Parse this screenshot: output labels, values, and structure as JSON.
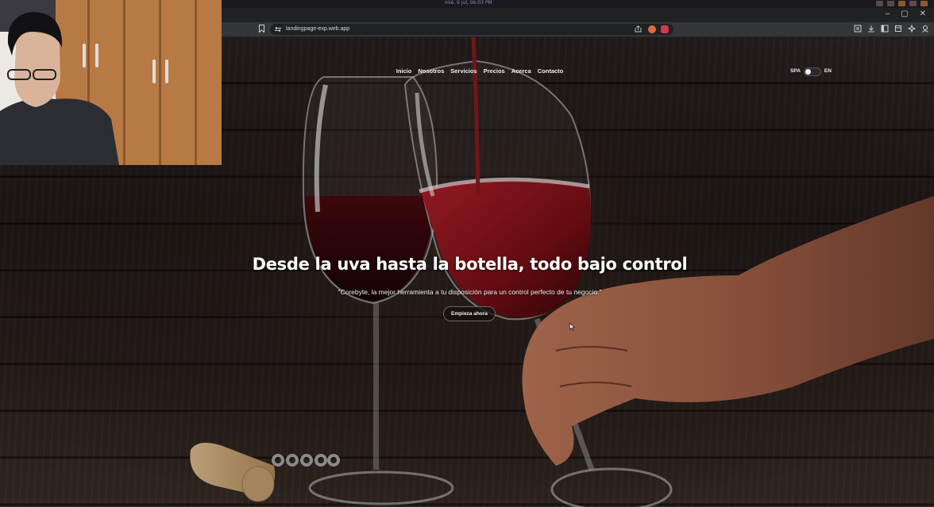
{
  "os_bar": {
    "clock": "mié, 9 jul, 06:03 PM"
  },
  "browser": {
    "url": "landingpage-exp.web.app",
    "icons": [
      "bookmark-icon",
      "site-info-icon",
      "share-icon",
      "extension-icon",
      "downloads-icon",
      "sidebar-icon",
      "profile-icon"
    ]
  },
  "nav": {
    "items": [
      "Inicio",
      "Nosotros",
      "Servicios",
      "Precios",
      "Acerca",
      "Contacto"
    ]
  },
  "lang": {
    "esp": "SPA",
    "en": "EN",
    "toggle_on": false
  },
  "hero": {
    "headline": "Desde la uva hasta la botella, todo bajo control",
    "subline": "\"Corebyte, la mejor herramienta a tu disposición para un control perfecto de tu negocio.\"",
    "cta": "Empieza ahora"
  },
  "colors": {
    "accent": "#8b1a1a",
    "wine": "#5a0f12",
    "wood": "#2c2523"
  }
}
